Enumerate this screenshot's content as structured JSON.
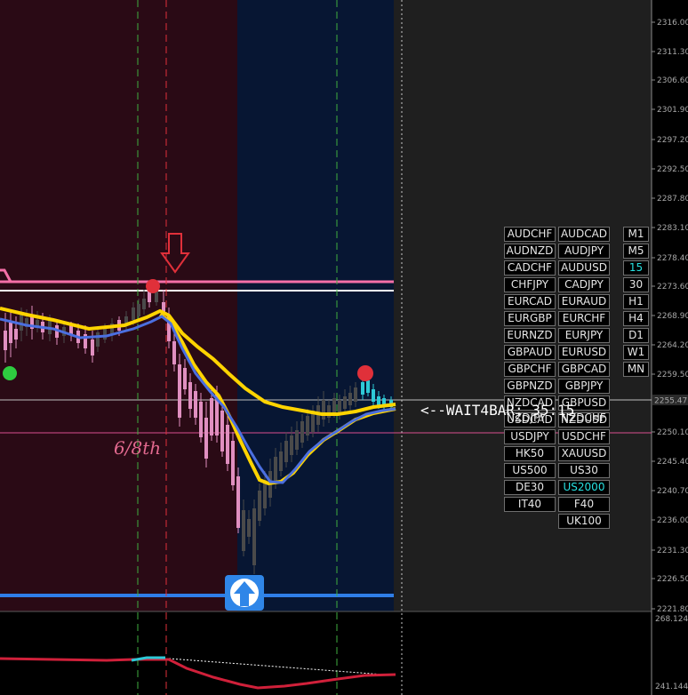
{
  "price_axis": {
    "labels": [
      "2316.00",
      "2311.30",
      "2306.60",
      "2301.90",
      "2297.20",
      "2292.50",
      "2287.80",
      "2283.10",
      "2278.40",
      "2273.60",
      "2268.90",
      "2264.20",
      "2259.50",
      "2250.10",
      "2245.40",
      "2240.70",
      "2236.00",
      "2231.30",
      "2226.50",
      "2221.80"
    ],
    "current_price": "2255.47"
  },
  "indicator_axis": {
    "top": "268.1242",
    "bottom": "241.1447"
  },
  "annotations": {
    "wait_label": "<--WAIT4BAR: 35:15",
    "fraction_label": "6/8th"
  },
  "symbols": {
    "left": [
      "AUDCHF",
      "AUDNZD",
      "CADCHF",
      "CHFJPY",
      "EURCAD",
      "EURGBP",
      "EURNZD",
      "GBPAUD",
      "GBPCHF",
      "GBPNZD",
      "NZDCAD",
      "USDCAD",
      "USDJPY",
      "HK50",
      "US500",
      "DE30",
      "IT40"
    ],
    "right": [
      "AUDCAD",
      "AUDJPY",
      "AUDUSD",
      "CADJPY",
      "EURAUD",
      "EURCHF",
      "EURJPY",
      "EURUSD",
      "GBPCAD",
      "GBPJPY",
      "GBPUSD",
      "NZDUSD",
      "USDCHF",
      "XAUUSD",
      "US30",
      "US2000",
      "F40",
      "UK100"
    ],
    "overlay_text": [
      "NZDJPY",
      "NZDCHF"
    ],
    "active": "US2000"
  },
  "timeframes": {
    "items": [
      "M1",
      "M5",
      "15",
      "30",
      "H1",
      "H4",
      "D1",
      "W1",
      "MN"
    ],
    "active": "15"
  },
  "colors": {
    "bearish_zone": "#2a0a15",
    "bullish_zone": "#071633",
    "pink_line": "#f46fa7",
    "blue_line": "#2f7ee8",
    "yellow_ma": "#ffd400",
    "blue_ma": "#4b6fe0",
    "bull_candle": "#4a4a4a",
    "bear_candle": "#e08fc0",
    "cyan_candle": "#2ec9d6"
  }
}
